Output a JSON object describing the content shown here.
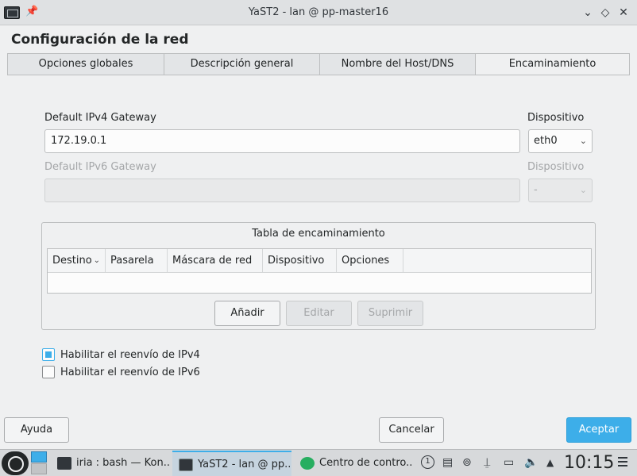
{
  "window": {
    "title": "YaST2 - lan @ pp-master16",
    "pin_glyph": "📌",
    "minimize_glyph": "⌄",
    "maximize_glyph": "◇",
    "close_glyph": "✕"
  },
  "page": {
    "title": "Configuración de la red"
  },
  "tabs": [
    {
      "label": "Opciones globales",
      "active": false
    },
    {
      "label": "Descripción general",
      "active": false
    },
    {
      "label": "Nombre del Host/DNS",
      "active": false
    },
    {
      "label": "Encaminamiento",
      "active": true
    }
  ],
  "routing": {
    "ipv4_gateway_label": "Default IPv4 Gateway",
    "ipv4_gateway_value": "172.19.0.1",
    "ipv4_device_label": "Dispositivo",
    "ipv4_device_value": "eth0",
    "ipv6_gateway_label": "Default IPv6 Gateway",
    "ipv6_gateway_value": "",
    "ipv6_device_label": "Dispositivo",
    "ipv6_device_value": "-",
    "table_title": "Tabla de encaminamiento",
    "columns": [
      "Destino",
      "Pasarela",
      "Máscara de red",
      "Dispositivo",
      "Opciones"
    ],
    "sort_glyph": "⌄",
    "rows": [],
    "add_label": "Añadir",
    "edit_label": "Editar",
    "delete_label": "Suprimir",
    "ipv4_forwarding_label": "Habilitar el reenvío de IPv4",
    "ipv4_forwarding_checked": true,
    "ipv6_forwarding_label": "Habilitar el reenvío de IPv6",
    "ipv6_forwarding_checked": false
  },
  "footer": {
    "help_label": "Ayuda",
    "cancel_label": "Cancelar",
    "accept_label": "Aceptar"
  },
  "taskbar": {
    "tasks": [
      {
        "label": "iria : bash — Kon...",
        "icon": "terminal-icon"
      },
      {
        "label": "YaST2 - lan @ pp...",
        "icon": "yast-icon"
      },
      {
        "label": "Centro de contro...",
        "icon": "control-center-icon"
      }
    ],
    "tray_notifications_badge": "1",
    "clock": "10:15"
  },
  "colors": {
    "accent": "#3daee9",
    "window_bg": "#eff0f1"
  }
}
